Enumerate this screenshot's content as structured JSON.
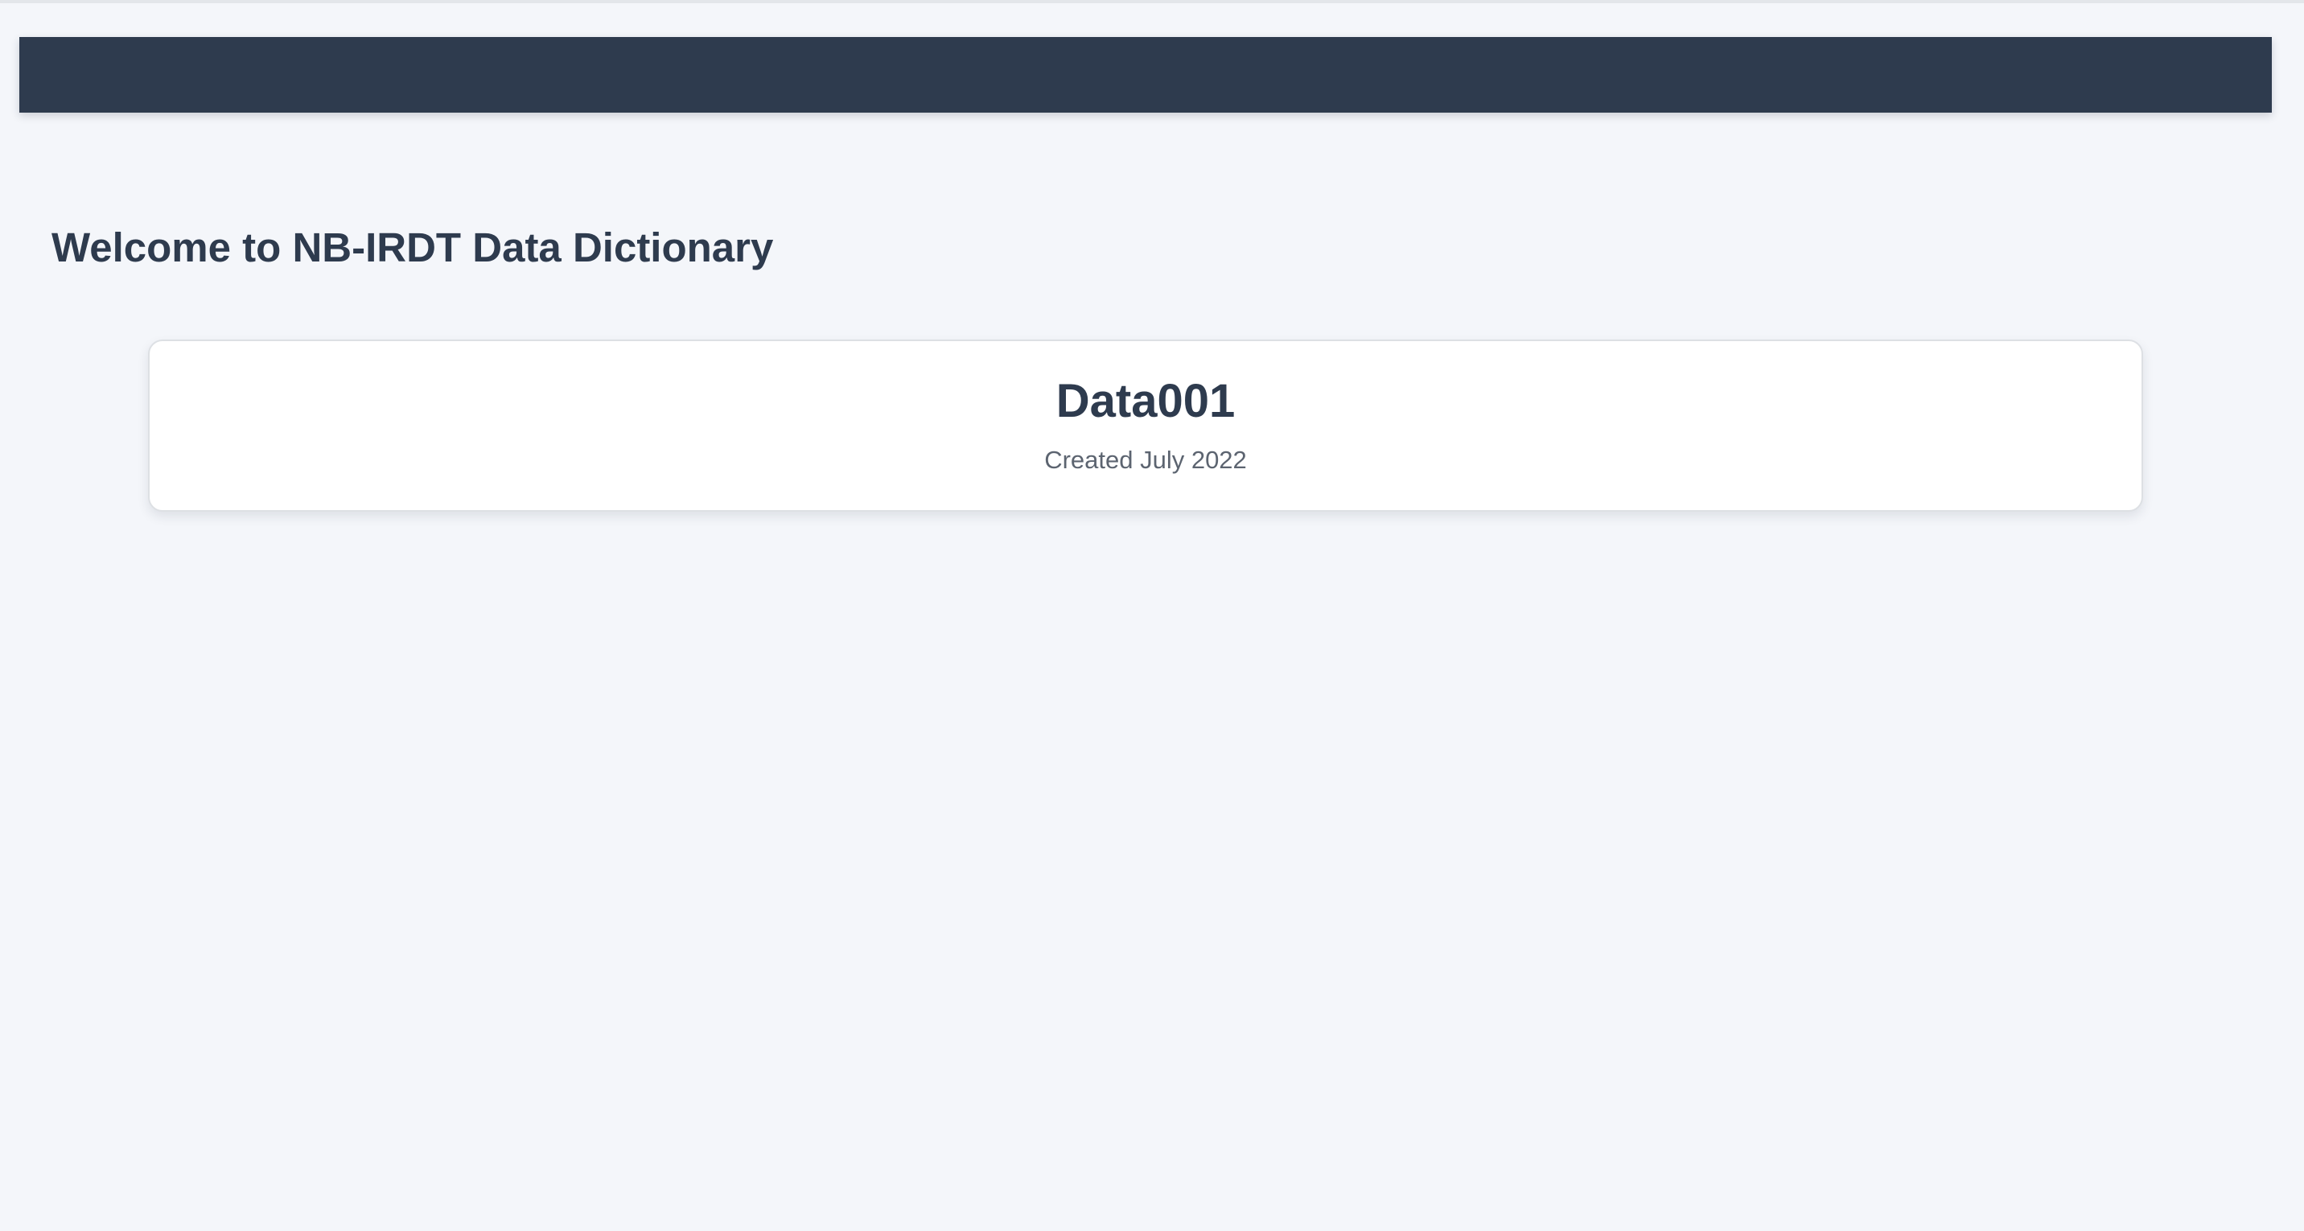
{
  "page": {
    "heading": "Welcome to NB-IRDT Data Dictionary"
  },
  "dictionaries": [
    {
      "name": "Data001",
      "created": "Created July 2022"
    }
  ],
  "colors": {
    "navbar": "#2e3b4e",
    "background": "#f4f6fa",
    "card": "#ffffff",
    "heading_text": "#2e3b4e",
    "muted_text": "#5c6470"
  }
}
